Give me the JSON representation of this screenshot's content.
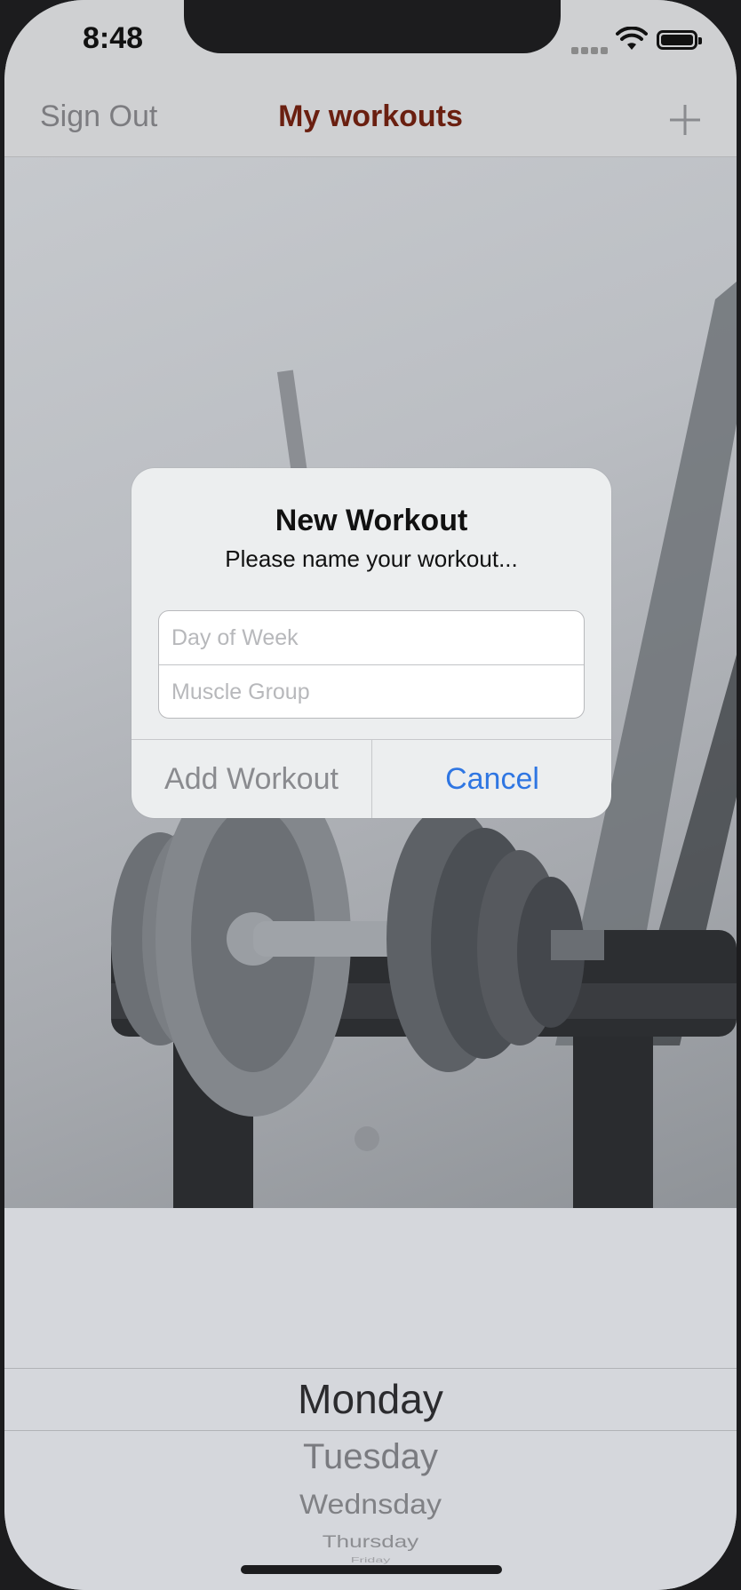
{
  "status_bar": {
    "time": "8:48",
    "signal_icon": "cellular-signal-icon",
    "wifi_icon": "wifi-icon",
    "battery_icon": "battery-icon"
  },
  "nav_bar": {
    "left_label": "Sign Out",
    "title": "My workouts",
    "add_icon": "plus-icon",
    "title_color": "#6a1f10"
  },
  "background_image": "dumbbell-on-bench-photo",
  "alert": {
    "title": "New Workout",
    "message": "Please name your workout...",
    "field_day_placeholder": "Day of Week",
    "field_muscle_placeholder": "Muscle Group",
    "add_label": "Add Workout",
    "cancel_label": "Cancel",
    "cancel_color": "#2f76e2"
  },
  "picker": {
    "items": [
      "Monday",
      "Tuesday",
      "Wednsday",
      "Thursday",
      "Friday"
    ],
    "selected": "Monday"
  }
}
